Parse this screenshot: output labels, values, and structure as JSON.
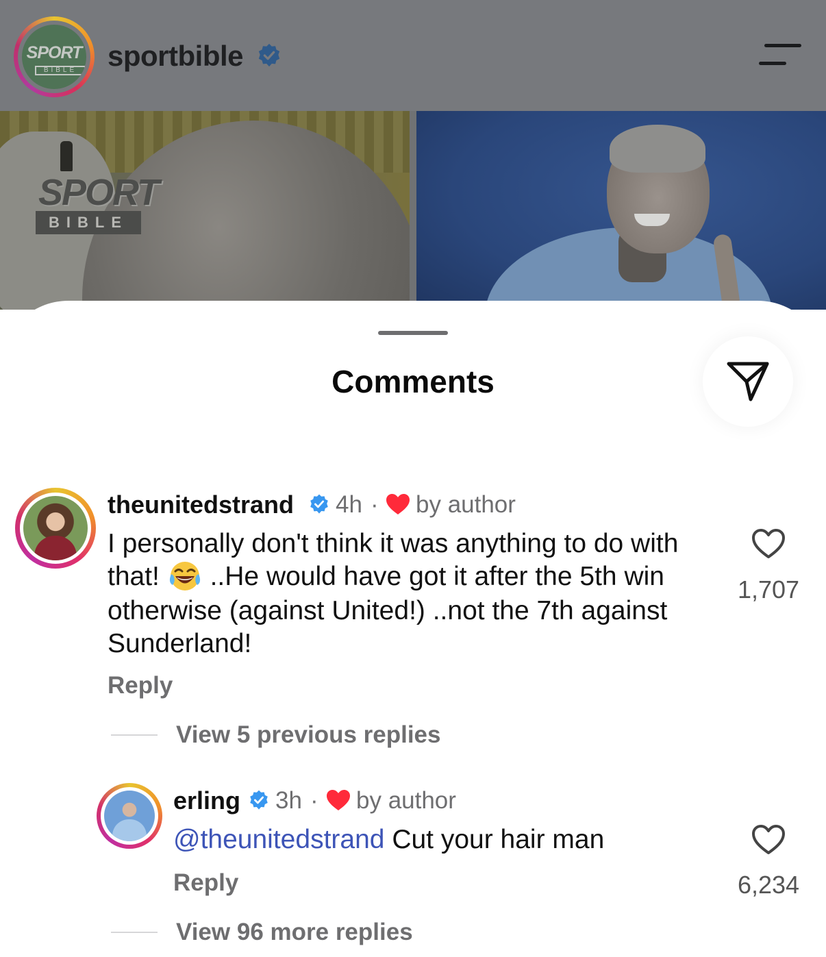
{
  "post": {
    "account_name": "sportbible",
    "logo_text_top": "SPORT",
    "logo_text_bottom": "BIBLE",
    "watermark_top": "SPORT",
    "watermark_bottom": "BIBLE"
  },
  "sheet": {
    "title": "Comments"
  },
  "comments": [
    {
      "username": "theunitedstrand",
      "time": "4h",
      "liked_by": "by author",
      "text": "I personally don't think it was anything to do with that! 😂 ..He would have got it after the 5th win otherwise (against United!) ..not the 7th against Sunderland!",
      "text_parts": [
        "I personally don't think it was anything to do with that!",
        "..He would have got it after the 5th win otherwise (against United!) ..not the 7th against Sunderland!"
      ],
      "reply_label": "Reply",
      "likes": "1,707",
      "view_replies": "View 5 previous replies"
    },
    {
      "username": "erling",
      "time": "3h",
      "liked_by": "by author",
      "mention": "@theunitedstrand",
      "text": "Cut your hair man",
      "reply_label": "Reply",
      "likes": "6,234",
      "view_replies": "View 96 more replies"
    }
  ],
  "colors": {
    "verified": "#3897f0",
    "mention": "#3d54b7",
    "heart": "#ff2a3a",
    "secondary_text": "#6e6e70"
  },
  "icons": [
    "verified-badge-icon",
    "menu-icon",
    "share-icon",
    "heart-icon",
    "heart-outline-icon",
    "laughing-emoji-icon"
  ]
}
